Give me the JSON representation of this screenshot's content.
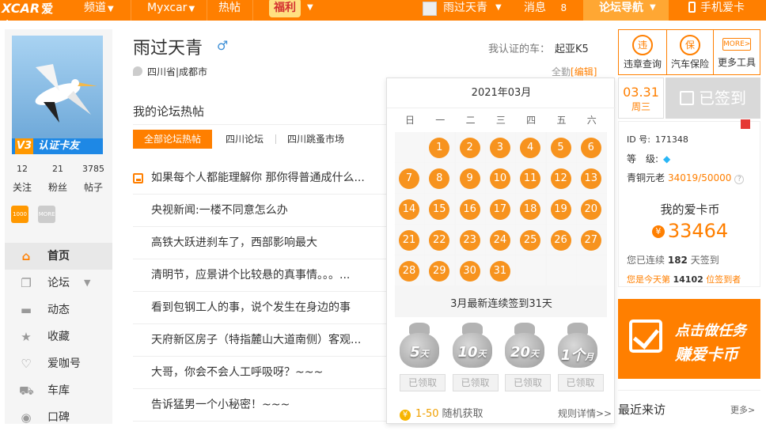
{
  "topbar": {
    "logo_main": "XCAR",
    "logo_sub": "爱卡",
    "nav": [
      {
        "label": "频道"
      },
      {
        "label": "Myxcar"
      },
      {
        "label": "热帖"
      }
    ],
    "fuli_label": "福利",
    "user_name": "雨过天青",
    "messages_label": "消息",
    "messages_count": "8",
    "forum_nav_label": "论坛导航",
    "mobile_label": "手机爱卡"
  },
  "sidebar": {
    "badge_text": "认证卡友",
    "badge_level": "V3",
    "stats": [
      {
        "value": "12",
        "label": "关注"
      },
      {
        "value": "21",
        "label": "粉丝"
      },
      {
        "value": "3785",
        "label": "帖子"
      }
    ],
    "mini_badges": [
      "1000",
      "MORE"
    ],
    "menu": [
      {
        "label": "首页",
        "icon": "home-icon"
      },
      {
        "label": "论坛",
        "icon": "forum-icon"
      },
      {
        "label": "动态",
        "icon": "chat-icon"
      },
      {
        "label": "收藏",
        "icon": "star-icon"
      },
      {
        "label": "爱咖号",
        "icon": "heart-icon"
      },
      {
        "label": "车库",
        "icon": "car-icon"
      },
      {
        "label": "口碑",
        "icon": "lips-icon"
      }
    ]
  },
  "profile": {
    "name": "雨过天青",
    "gender_icon": "male-icon",
    "location": "四川省|成都市",
    "car_label": "我认证的车：",
    "car_value": "起亚K5",
    "qq_label": "全勤",
    "edit_label": "[编辑]"
  },
  "forum": {
    "title": "我的论坛热帖",
    "tabs": [
      "全部论坛热帖",
      "四川论坛",
      "四川跳蚤市场"
    ],
    "posts": [
      "如果每个人都能理解你 那你得普通成什么...",
      "央视新闻:一楼不同意怎么办",
      "高铁大跃进刹车了，西部影响最大",
      "清明节，应景讲个比较悬的真事情。。。...",
      "看到包钢工人的事，说个发生在身边的事",
      "天府新区房子（特指麓山大道南侧）客观...",
      "大哥，你会不会人工呼吸呀？~~~",
      "告诉猛男一个小秘密！~~~"
    ]
  },
  "calendar": {
    "month_title": "2021年03月",
    "weekdays": [
      "日",
      "一",
      "二",
      "三",
      "四",
      "五",
      "六"
    ],
    "first_weekday_index": 1,
    "days_in_month": 31,
    "signed_days": [
      1,
      2,
      3,
      4,
      5,
      6,
      7,
      8,
      9,
      10,
      11,
      12,
      13,
      14,
      15,
      16,
      17,
      18,
      19,
      20,
      21,
      22,
      23,
      24,
      25,
      26,
      27,
      28,
      29,
      30,
      31
    ],
    "streak_text": "3月最新连续签到31天",
    "rewards": [
      {
        "num": "5",
        "unit": "天"
      },
      {
        "num": "10",
        "unit": "天"
      },
      {
        "num": "20",
        "unit": "天"
      },
      {
        "num": "1个",
        "unit": "月"
      }
    ],
    "claim_label": "已领取",
    "foot_range": "1-50",
    "foot_text": "随机获取",
    "rules_label": "规则详情>>"
  },
  "quick_links": [
    {
      "label": "违章查询",
      "glyph": "违"
    },
    {
      "label": "汽车保险",
      "glyph": "保"
    },
    {
      "label": "更多工具",
      "glyph": "MORE>"
    }
  ],
  "signin": {
    "date": "03.31",
    "weekday": "周三",
    "status": "已签到"
  },
  "account": {
    "id_label": "ID 号:",
    "id_value": "171348",
    "level_label": "等　级:",
    "copper_label": "青铜元老",
    "copper_value": "34019/50000",
    "coins_title": "我的爱卡币",
    "coins_value": "33464",
    "streak_prefix": "您已连续",
    "streak_days": "182",
    "streak_suffix": "天签到",
    "rank_prefix": "您是今天第",
    "rank_value": "14102",
    "rank_suffix": "位签到者"
  },
  "banner": {
    "line1": "点击做任务",
    "line2": "赚爱卡币"
  },
  "recent": {
    "title": "最近来访",
    "more": "更多>"
  },
  "colors": {
    "brand_orange": "#ff7f00",
    "day_circle": "#f7931e",
    "signed_gray": "#d9d9d9"
  }
}
